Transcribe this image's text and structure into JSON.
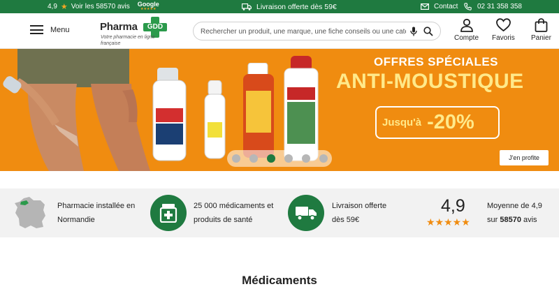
{
  "topbar": {
    "rating": "4,9",
    "reviews_text": "Voir les 58570 avis",
    "google_label": "Google",
    "shipping": "Livraison offerte dès 59€",
    "contact": "Contact",
    "phone": "02 31 358 358",
    "bg_color": "#1f7a40"
  },
  "header": {
    "menu_label": "Menu",
    "logo_brand": "Pharma",
    "logo_mark": "GDD",
    "logo_tagline": "Votre pharmacie en ligne française",
    "search_placeholder": "Rechercher un produit, une marque, une fiche conseils ou une catégorie",
    "account_label": "Compte",
    "favorites_label": "Favoris",
    "cart_label": "Panier"
  },
  "banner": {
    "title_line1": "OFFRES SPÉCIALES",
    "title_line2": "ANTI-MOUSTIQUE",
    "promo_prefix": "Jusqu'à",
    "promo_value": "-20%",
    "cta_label": "J'en profite",
    "bg_color": "#f08c10",
    "carousel_active_index": 2,
    "carousel_count": 6
  },
  "reassurance": {
    "item1_line1": "Pharmacie installée en",
    "item1_line2": "Normandie",
    "item2_line1": "25 000 médicaments et",
    "item2_line2": "produits de santé",
    "item3_line1": "Livraison offerte",
    "item3_line2": "dès 59€",
    "rating_value": "4,9",
    "rating_stars": "★★★★★",
    "rating_prefix": "Moyenne de 4,9",
    "rating_sur": "sur",
    "rating_count": "58570",
    "rating_suffix": "avis"
  },
  "main": {
    "section_title": "Médicaments"
  }
}
